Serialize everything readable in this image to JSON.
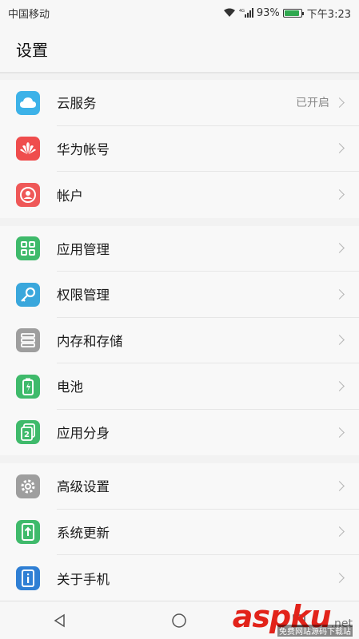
{
  "status_bar": {
    "carrier": "中国移动",
    "network": "4G",
    "battery_percent_text": "93%",
    "battery_level": 0.93,
    "time": "下午3:23"
  },
  "header": {
    "title": "设置"
  },
  "groups": [
    {
      "items": [
        {
          "label": "云服务",
          "value": "已开启",
          "icon": "cloud-icon",
          "color": "#3db2e8"
        },
        {
          "label": "华为帐号",
          "value": "",
          "icon": "huawei-logo-icon",
          "color": "#ef4d4d"
        },
        {
          "label": "帐户",
          "value": "",
          "icon": "user-icon",
          "color": "#ef5858"
        }
      ]
    },
    {
      "items": [
        {
          "label": "应用管理",
          "value": "",
          "icon": "apps-grid-icon",
          "color": "#3fba6b"
        },
        {
          "label": "权限管理",
          "value": "",
          "icon": "key-icon",
          "color": "#3aa7dc"
        },
        {
          "label": "内存和存储",
          "value": "",
          "icon": "storage-icon",
          "color": "#9e9e9e"
        },
        {
          "label": "电池",
          "value": "",
          "icon": "battery-icon",
          "color": "#3fba6b"
        },
        {
          "label": "应用分身",
          "value": "",
          "icon": "app-twin-icon",
          "color": "#3fba6b"
        }
      ]
    },
    {
      "items": [
        {
          "label": "高级设置",
          "value": "",
          "icon": "gear-icon",
          "color": "#9e9e9e"
        },
        {
          "label": "系统更新",
          "value": "",
          "icon": "update-icon",
          "color": "#3fba6b"
        },
        {
          "label": "关于手机",
          "value": "",
          "icon": "info-icon",
          "color": "#2f7fd4"
        }
      ]
    }
  ],
  "watermark": {
    "brand": "aspku",
    "suffix": ".net",
    "subtitle": "免费网站源码下载站"
  },
  "nav": {
    "back": "back-icon",
    "home": "home-icon",
    "recent": "recent-apps-icon"
  }
}
